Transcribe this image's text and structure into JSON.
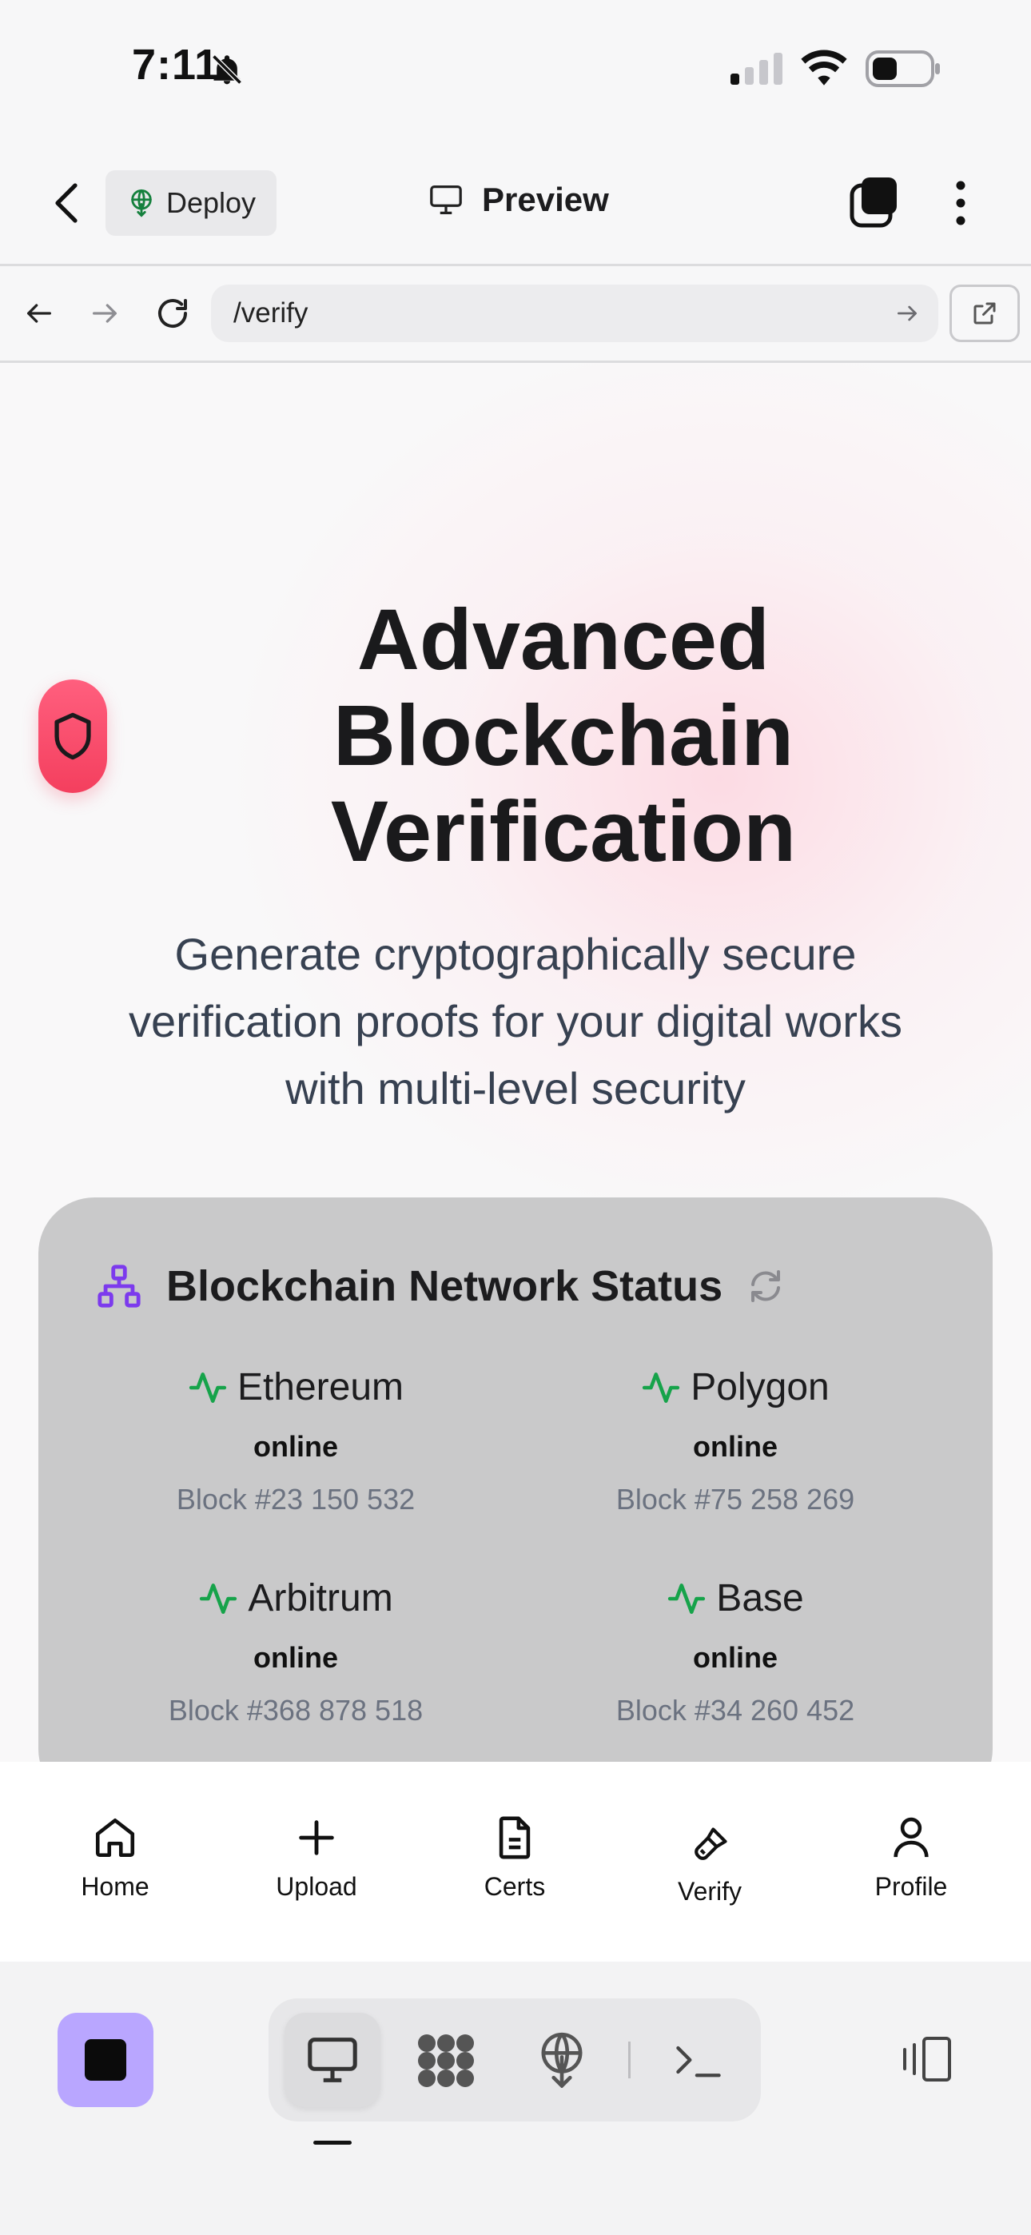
{
  "status_bar": {
    "time": "7:11"
  },
  "top_bar": {
    "deploy_label": "Deploy",
    "preview_label": "Preview"
  },
  "url_bar": {
    "value": "/verify"
  },
  "hero": {
    "title_line1": "Advanced",
    "title_line2": "Blockchain",
    "title_line3": "Verification",
    "subtitle_line1": "Generate cryptographically secure",
    "subtitle_line2": "verification proofs for your digital works",
    "subtitle_line3": "with multi-level security"
  },
  "network_card": {
    "title": "Blockchain Network Status",
    "networks": [
      {
        "name": "Ethereum",
        "status": "online",
        "block": "Block #23 150 532"
      },
      {
        "name": "Polygon",
        "status": "online",
        "block": "Block #75 258 269"
      },
      {
        "name": "Arbitrum",
        "status": "online",
        "block": "Block #368 878 518"
      },
      {
        "name": "Base",
        "status": "online",
        "block": "Block #34 260 452"
      }
    ]
  },
  "tabs": [
    {
      "label": "Home",
      "icon": "home-icon"
    },
    {
      "label": "Upload",
      "icon": "plus-icon"
    },
    {
      "label": "Certs",
      "icon": "document-icon"
    },
    {
      "label": "Verify",
      "icon": "brush-icon"
    },
    {
      "label": "Profile",
      "icon": "user-icon"
    }
  ],
  "colors": {
    "accent_green": "#16a34a",
    "accent_purple": "#7c3aed",
    "shield_red": "#f43f5e",
    "stop_button": "#b9a6ff"
  }
}
